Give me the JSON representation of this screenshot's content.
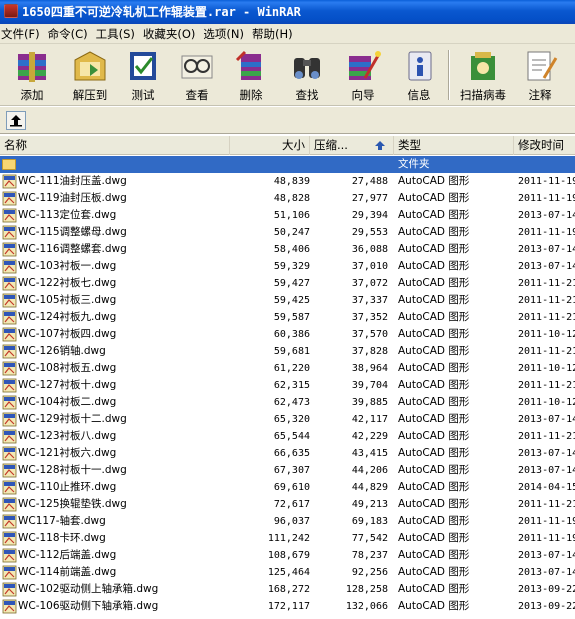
{
  "window": {
    "title": "1650四重不可逆冷轧机工作辊装置.rar - WinRAR"
  },
  "menu": [
    "文件(F)",
    "命令(C)",
    "工具(S)",
    "收藏夹(O)",
    "选项(N)",
    "帮助(H)"
  ],
  "toolbar": [
    {
      "label": "添加",
      "icon": "add-archive-icon"
    },
    {
      "label": "解压到",
      "icon": "extract-to-icon"
    },
    {
      "label": "测试",
      "icon": "test-icon"
    },
    {
      "label": "查看",
      "icon": "view-icon"
    },
    {
      "label": "删除",
      "icon": "delete-icon"
    },
    {
      "label": "查找",
      "icon": "find-icon"
    },
    {
      "label": "向导",
      "icon": "wizard-icon"
    },
    {
      "label": "信息",
      "icon": "info-icon"
    },
    {
      "label": "扫描病毒",
      "icon": "virus-scan-icon"
    },
    {
      "label": "注释",
      "icon": "comment-icon"
    }
  ],
  "columns": {
    "name": "名称",
    "size": "大小",
    "compressed": "压缩...",
    "type": "类型",
    "modified": "修改时间"
  },
  "parent_row": {
    "type": "文件夹"
  },
  "files": [
    {
      "name": "WC-111油封压盖.dwg",
      "size": "48,839",
      "compressed": "27,488",
      "type": "AutoCAD 图形",
      "modified": "2011-11-19"
    },
    {
      "name": "WC-119油封压板.dwg",
      "size": "48,828",
      "compressed": "27,977",
      "type": "AutoCAD 图形",
      "modified": "2011-11-19"
    },
    {
      "name": "WC-113定位套.dwg",
      "size": "51,106",
      "compressed": "29,394",
      "type": "AutoCAD 图形",
      "modified": "2013-07-14"
    },
    {
      "name": "WC-115调整螺母.dwg",
      "size": "50,247",
      "compressed": "29,553",
      "type": "AutoCAD 图形",
      "modified": "2011-11-19"
    },
    {
      "name": "WC-116调整螺套.dwg",
      "size": "58,406",
      "compressed": "36,088",
      "type": "AutoCAD 图形",
      "modified": "2013-07-14"
    },
    {
      "name": "WC-103衬板一.dwg",
      "size": "59,329",
      "compressed": "37,010",
      "type": "AutoCAD 图形",
      "modified": "2013-07-14"
    },
    {
      "name": "WC-122衬板七.dwg",
      "size": "59,427",
      "compressed": "37,072",
      "type": "AutoCAD 图形",
      "modified": "2011-11-21"
    },
    {
      "name": "WC-105衬板三.dwg",
      "size": "59,425",
      "compressed": "37,337",
      "type": "AutoCAD 图形",
      "modified": "2011-11-21"
    },
    {
      "name": "WC-124衬板九.dwg",
      "size": "59,587",
      "compressed": "37,352",
      "type": "AutoCAD 图形",
      "modified": "2011-11-21"
    },
    {
      "name": "WC-107衬板四.dwg",
      "size": "60,386",
      "compressed": "37,570",
      "type": "AutoCAD 图形",
      "modified": "2011-10-12"
    },
    {
      "name": "WC-126销轴.dwg",
      "size": "59,681",
      "compressed": "37,828",
      "type": "AutoCAD 图形",
      "modified": "2011-11-21"
    },
    {
      "name": "WC-108衬板五.dwg",
      "size": "61,220",
      "compressed": "38,964",
      "type": "AutoCAD 图形",
      "modified": "2011-10-12"
    },
    {
      "name": "WC-127衬板十.dwg",
      "size": "62,315",
      "compressed": "39,704",
      "type": "AutoCAD 图形",
      "modified": "2011-11-21"
    },
    {
      "name": "WC-104衬板二.dwg",
      "size": "62,473",
      "compressed": "39,885",
      "type": "AutoCAD 图形",
      "modified": "2011-10-12"
    },
    {
      "name": "WC-129衬板十二.dwg",
      "size": "65,320",
      "compressed": "42,117",
      "type": "AutoCAD 图形",
      "modified": "2013-07-14"
    },
    {
      "name": "WC-123衬板八.dwg",
      "size": "65,544",
      "compressed": "42,229",
      "type": "AutoCAD 图形",
      "modified": "2011-11-21"
    },
    {
      "name": "WC-121衬板六.dwg",
      "size": "66,635",
      "compressed": "43,415",
      "type": "AutoCAD 图形",
      "modified": "2013-07-14"
    },
    {
      "name": "WC-128衬板十一.dwg",
      "size": "67,307",
      "compressed": "44,206",
      "type": "AutoCAD 图形",
      "modified": "2013-07-14"
    },
    {
      "name": "WC-110止推环.dwg",
      "size": "69,610",
      "compressed": "44,829",
      "type": "AutoCAD 图形",
      "modified": "2014-04-15"
    },
    {
      "name": "WC-125换辊垫铁.dwg",
      "size": "72,617",
      "compressed": "49,213",
      "type": "AutoCAD 图形",
      "modified": "2011-11-21"
    },
    {
      "name": "WC117-轴套.dwg",
      "size": "96,037",
      "compressed": "69,183",
      "type": "AutoCAD 图形",
      "modified": "2011-11-19"
    },
    {
      "name": "WC-118卡环.dwg",
      "size": "111,242",
      "compressed": "77,542",
      "type": "AutoCAD 图形",
      "modified": "2011-11-19"
    },
    {
      "name": "WC-112后端盖.dwg",
      "size": "108,679",
      "compressed": "78,237",
      "type": "AutoCAD 图形",
      "modified": "2013-07-14"
    },
    {
      "name": "WC-114前端盖.dwg",
      "size": "125,464",
      "compressed": "92,256",
      "type": "AutoCAD 图形",
      "modified": "2013-07-14"
    },
    {
      "name": "WC-102驱动侧上轴承箱.dwg",
      "size": "168,272",
      "compressed": "128,258",
      "type": "AutoCAD 图形",
      "modified": "2013-09-22"
    },
    {
      "name": "WC-106驱动侧下轴承箱.dwg",
      "size": "172,117",
      "compressed": "132,066",
      "type": "AutoCAD 图形",
      "modified": "2013-09-22"
    }
  ]
}
